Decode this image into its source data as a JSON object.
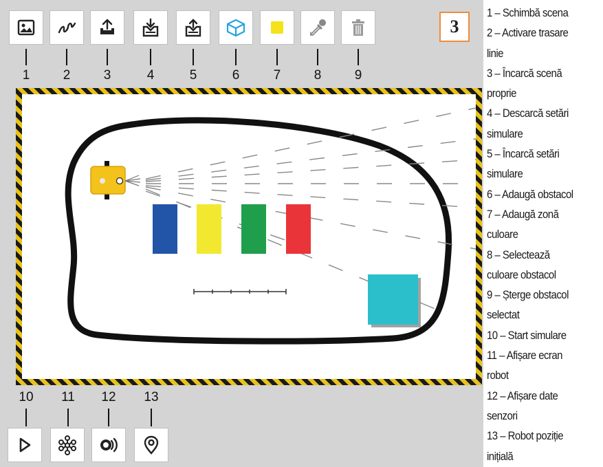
{
  "toolbar_top": [
    {
      "num": "1",
      "icon": "image-icon",
      "name": "change-scene-button"
    },
    {
      "num": "2",
      "icon": "line-trace-icon",
      "name": "line-trace-button"
    },
    {
      "num": "3",
      "icon": "upload-scene-icon",
      "name": "upload-scene-button"
    },
    {
      "num": "4",
      "icon": "download-settings-icon",
      "name": "download-settings-button"
    },
    {
      "num": "5",
      "icon": "upload-settings-icon",
      "name": "upload-settings-button"
    },
    {
      "num": "6",
      "icon": "cube-icon",
      "name": "add-obstacle-button"
    },
    {
      "num": "7",
      "icon": "color-square-icon",
      "name": "add-color-zone-button"
    },
    {
      "num": "8",
      "icon": "eyedropper-icon",
      "name": "select-color-button"
    },
    {
      "num": "9",
      "icon": "trash-icon",
      "name": "delete-obstacle-button"
    }
  ],
  "toolbar_bottom": [
    {
      "num": "10",
      "icon": "play-icon",
      "name": "start-simulation-button"
    },
    {
      "num": "11",
      "icon": "network-icon",
      "name": "robot-screen-button"
    },
    {
      "num": "12",
      "icon": "sensor-icon",
      "name": "sensor-data-button"
    },
    {
      "num": "13",
      "icon": "location-pin-icon",
      "name": "robot-initial-position-button"
    }
  ],
  "badge": "3",
  "legend": [
    "1 – Schimbă scena",
    "2 – Activare trasare",
    "linie",
    "3 – Încarcă scenă",
    "proprie",
    "4 – Descarcă setări",
    "simulare",
    "5 – Încarcă setări",
    "simulare",
    "6 – Adaugă obstacol",
    "7 – Adaugă zonă",
    "culoare",
    "8 – Selectează",
    "culoare obstacol",
    "9 – Șterge obstacol",
    "selectat",
    "10 – Start simulare",
    "11 – Afișare ecran",
    "robot",
    "12 – Afișare date",
    "senzori",
    "13 – Robot poziție",
    "inițială"
  ],
  "colors": {
    "blue_zone": "#2255a8",
    "yellow_zone": "#f2e830",
    "green_zone": "#1f9e4c",
    "red_zone": "#e9353a",
    "cyan_obstacle": "#2bbfcc",
    "robot": "#f3c21b",
    "badge_border": "#f08c3c",
    "cube_icon": "#27a3dd",
    "color_zone_icon": "#f5e21a"
  }
}
